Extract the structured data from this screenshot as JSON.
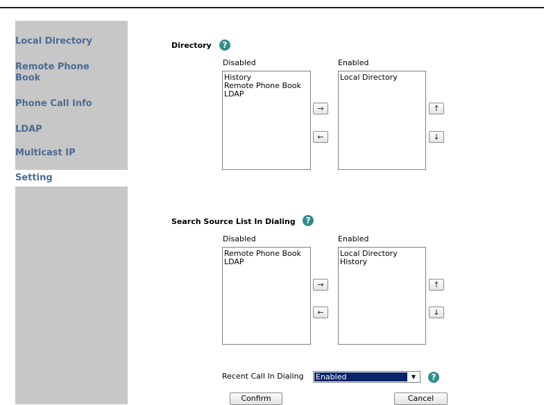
{
  "sidebar": {
    "items": [
      {
        "label": "Local Directory"
      },
      {
        "label": "Remote Phone Book"
      },
      {
        "label": "Phone Call Info"
      },
      {
        "label": "LDAP"
      },
      {
        "label": "Multicast IP"
      },
      {
        "label": "Setting"
      }
    ],
    "active": "Setting"
  },
  "directory": {
    "title": "Directory",
    "help_icon": "question-mark",
    "disabled_label": "Disabled",
    "enabled_label": "Enabled",
    "disabled_items": [
      "History",
      "Remote Phone Book",
      "LDAP"
    ],
    "enabled_items": [
      "Local Directory"
    ],
    "move_right": "→",
    "move_left": "←",
    "move_up": "↑",
    "move_down": "↓"
  },
  "search_source": {
    "title": "Search Source List In Dialing",
    "help_icon": "question-mark",
    "disabled_label": "Disabled",
    "enabled_label": "Enabled",
    "disabled_items": [
      "Remote Phone Book",
      "LDAP"
    ],
    "enabled_items": [
      "Local Directory",
      "History"
    ],
    "move_right": "→",
    "move_left": "←",
    "move_up": "↑",
    "move_down": "↓"
  },
  "recent_call": {
    "label": "Recent Call In Dialing",
    "selected": "Enabled",
    "help_icon": "question-mark"
  },
  "actions": {
    "confirm": "Confirm",
    "cancel": "Cancel"
  },
  "colors": {
    "sidebar_bg": "#c7c7c7",
    "nav_text": "#4c6b94",
    "help_icon": "#2f8e8a",
    "selected_bg": "#0a246a"
  }
}
